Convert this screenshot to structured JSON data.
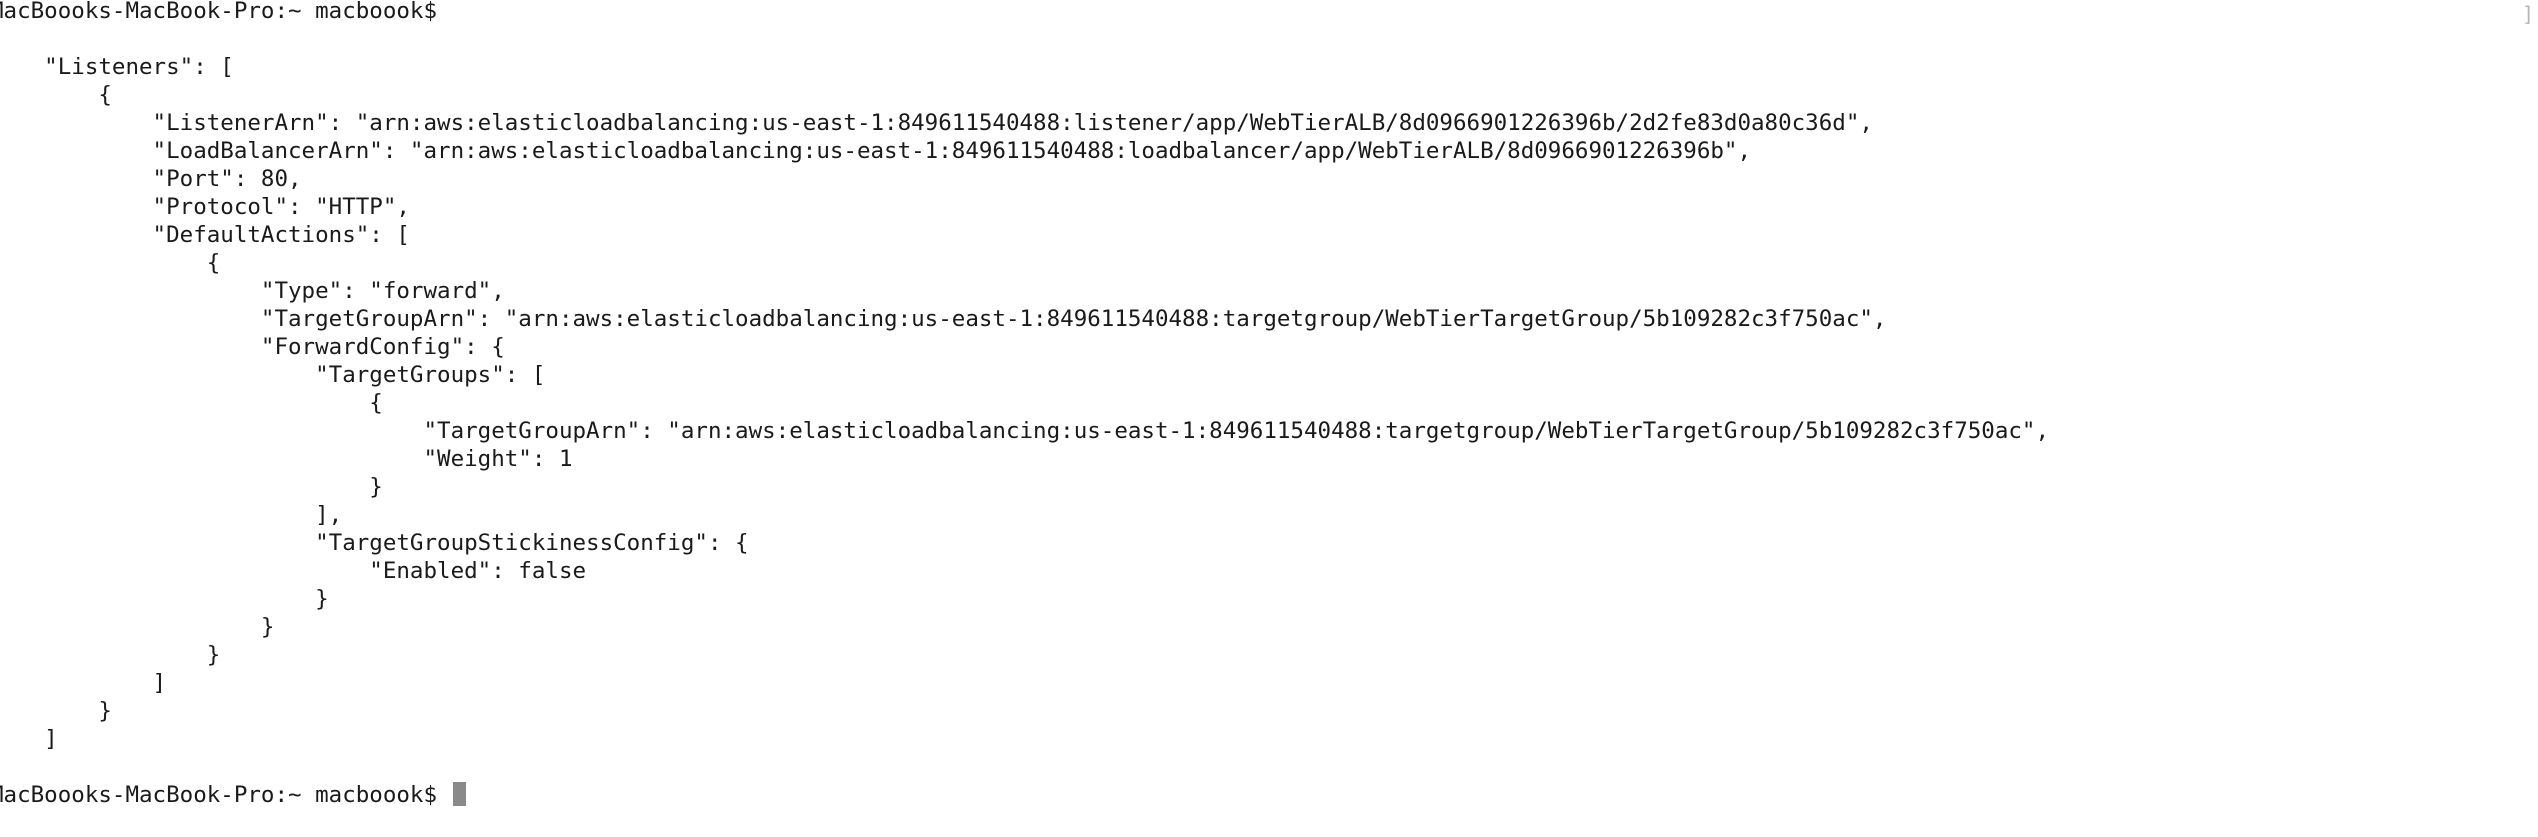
{
  "terminal": {
    "prompt_top": "MacBoooks-MacBook-Pro:~ macboook$",
    "prompt_bottom": "MacBoooks-MacBook-Pro:~ macboook$",
    "scrollbar_mark": "]",
    "output_lines": [
      "    \"Listeners\": [",
      "        {",
      "            \"ListenerArn\": \"arn:aws:elasticloadbalancing:us-east-1:849611540488:listener/app/WebTierALB/8d0966901226396b/2d2fe83d0a80c36d\",",
      "            \"LoadBalancerArn\": \"arn:aws:elasticloadbalancing:us-east-1:849611540488:loadbalancer/app/WebTierALB/8d0966901226396b\",",
      "            \"Port\": 80,",
      "            \"Protocol\": \"HTTP\",",
      "            \"DefaultActions\": [",
      "                {",
      "                    \"Type\": \"forward\",",
      "                    \"TargetGroupArn\": \"arn:aws:elasticloadbalancing:us-east-1:849611540488:targetgroup/WebTierTargetGroup/5b109282c3f750ac\",",
      "                    \"ForwardConfig\": {",
      "                        \"TargetGroups\": [",
      "                            {",
      "                                \"TargetGroupArn\": \"arn:aws:elasticloadbalancing:us-east-1:849611540488:targetgroup/WebTierTargetGroup/5b109282c3f750ac\",",
      "                                \"Weight\": 1",
      "                            }",
      "                        ],",
      "                        \"TargetGroupStickinessConfig\": {",
      "                            \"Enabled\": false",
      "                        }",
      "                    }",
      "                }",
      "            ]",
      "        }",
      "    ]"
    ]
  }
}
